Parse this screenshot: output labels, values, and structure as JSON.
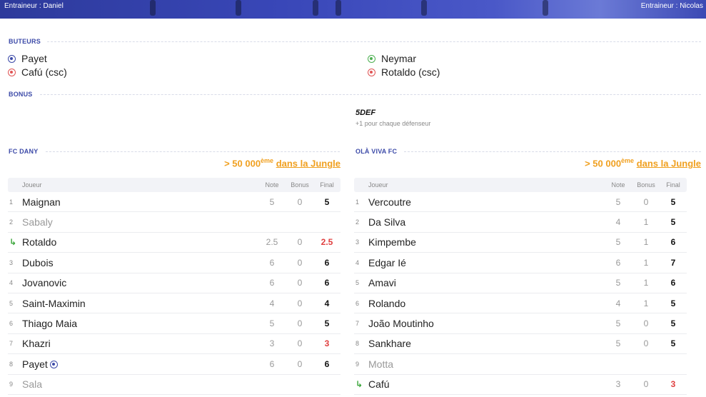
{
  "banner": {
    "home_coach": "Entraineur : Daniel",
    "away_coach": "Entraineur : Nicolas"
  },
  "sections": {
    "scorers_title": "BUTEURS",
    "bonus_title": "BONUS"
  },
  "scorers": {
    "home": [
      {
        "name": "Payet",
        "ball": "blue"
      },
      {
        "name": "Cafú (csc)",
        "ball": "red"
      }
    ],
    "away": [
      {
        "name": "Neymar",
        "ball": "green"
      },
      {
        "name": "Rotaldo (csc)",
        "ball": "red"
      }
    ]
  },
  "bonus": {
    "away_name": "5DEF",
    "away_desc": "+1 pour chaque défenseur"
  },
  "teams": {
    "home": {
      "name": "FC DANY",
      "rank_prefix": "> 50 000",
      "rank_sup": "ème",
      "rank_link": "dans la Jungle"
    },
    "away": {
      "name": "OLÀ VIVA FC",
      "rank_prefix": "> 50 000",
      "rank_sup": "ème",
      "rank_link": "dans la Jungle"
    }
  },
  "columns": {
    "player": "Joueur",
    "note": "Note",
    "bonus": "Bonus",
    "final": "Final"
  },
  "home_rows": [
    {
      "num": "1",
      "name": "Maignan",
      "note": "5",
      "bonus": "0",
      "final": "5",
      "dim": false,
      "sub": false,
      "red": false,
      "ball": false
    },
    {
      "num": "2",
      "name": "Sabaly",
      "note": "",
      "bonus": "",
      "final": "",
      "dim": true,
      "sub": false,
      "red": false,
      "ball": false
    },
    {
      "num": "↳",
      "name": "Rotaldo",
      "note": "2.5",
      "bonus": "0",
      "final": "2.5",
      "dim": false,
      "sub": true,
      "red": true,
      "ball": false
    },
    {
      "num": "3",
      "name": "Dubois",
      "note": "6",
      "bonus": "0",
      "final": "6",
      "dim": false,
      "sub": false,
      "red": false,
      "ball": false
    },
    {
      "num": "4",
      "name": "Jovanovic",
      "note": "6",
      "bonus": "0",
      "final": "6",
      "dim": false,
      "sub": false,
      "red": false,
      "ball": false
    },
    {
      "num": "5",
      "name": "Saint-Maximin",
      "note": "4",
      "bonus": "0",
      "final": "4",
      "dim": false,
      "sub": false,
      "red": false,
      "ball": false
    },
    {
      "num": "6",
      "name": "Thiago Maia",
      "note": "5",
      "bonus": "0",
      "final": "5",
      "dim": false,
      "sub": false,
      "red": false,
      "ball": false
    },
    {
      "num": "7",
      "name": "Khazri",
      "note": "3",
      "bonus": "0",
      "final": "3",
      "dim": false,
      "sub": false,
      "red": true,
      "ball": false
    },
    {
      "num": "8",
      "name": "Payet",
      "note": "6",
      "bonus": "0",
      "final": "6",
      "dim": false,
      "sub": false,
      "red": false,
      "ball": true
    },
    {
      "num": "9",
      "name": "Sala",
      "note": "",
      "bonus": "",
      "final": "",
      "dim": true,
      "sub": false,
      "red": false,
      "ball": false
    }
  ],
  "away_rows": [
    {
      "num": "1",
      "name": "Vercoutre",
      "note": "5",
      "bonus": "0",
      "final": "5",
      "dim": false,
      "sub": false,
      "red": false
    },
    {
      "num": "2",
      "name": "Da Silva",
      "note": "4",
      "bonus": "1",
      "final": "5",
      "dim": false,
      "sub": false,
      "red": false
    },
    {
      "num": "3",
      "name": "Kimpembe",
      "note": "5",
      "bonus": "1",
      "final": "6",
      "dim": false,
      "sub": false,
      "red": false
    },
    {
      "num": "4",
      "name": "Edgar Ié",
      "note": "6",
      "bonus": "1",
      "final": "7",
      "dim": false,
      "sub": false,
      "red": false
    },
    {
      "num": "5",
      "name": "Amavi",
      "note": "5",
      "bonus": "1",
      "final": "6",
      "dim": false,
      "sub": false,
      "red": false
    },
    {
      "num": "6",
      "name": "Rolando",
      "note": "4",
      "bonus": "1",
      "final": "5",
      "dim": false,
      "sub": false,
      "red": false
    },
    {
      "num": "7",
      "name": "João Moutinho",
      "note": "5",
      "bonus": "0",
      "final": "5",
      "dim": false,
      "sub": false,
      "red": false
    },
    {
      "num": "8",
      "name": "Sankhare",
      "note": "5",
      "bonus": "0",
      "final": "5",
      "dim": false,
      "sub": false,
      "red": false
    },
    {
      "num": "9",
      "name": "Motta",
      "note": "",
      "bonus": "",
      "final": "",
      "dim": true,
      "sub": false,
      "red": false
    },
    {
      "num": "↳",
      "name": "Cafú",
      "note": "3",
      "bonus": "0",
      "final": "3",
      "dim": false,
      "sub": true,
      "red": true
    }
  ]
}
